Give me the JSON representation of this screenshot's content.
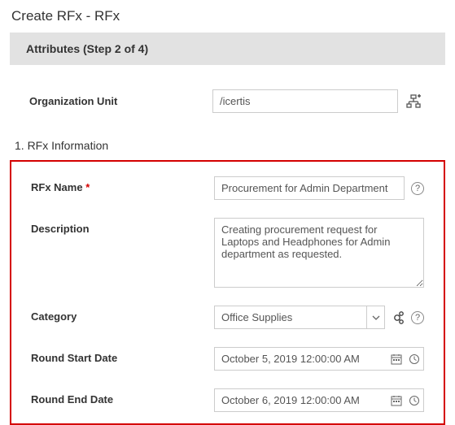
{
  "page_title": "Create RFx - RFx",
  "step_bar": "Attributes (Step 2 of 4)",
  "org": {
    "label": "Organization Unit",
    "value": "/icertis"
  },
  "section_title": "1. RFx Information",
  "fields": {
    "rfx_name": {
      "label": "RFx Name",
      "value": "Procurement for Admin Department"
    },
    "description": {
      "label": "Description",
      "value": "Creating procurement request for Laptops and Headphones for Admin department as requested."
    },
    "category": {
      "label": "Category",
      "value": "Office Supplies"
    },
    "round_start": {
      "label": "Round Start Date",
      "value": "October 5, 2019 12:00:00 AM"
    },
    "round_end": {
      "label": "Round End Date",
      "value": "October 6, 2019 12:00:00 AM"
    }
  }
}
